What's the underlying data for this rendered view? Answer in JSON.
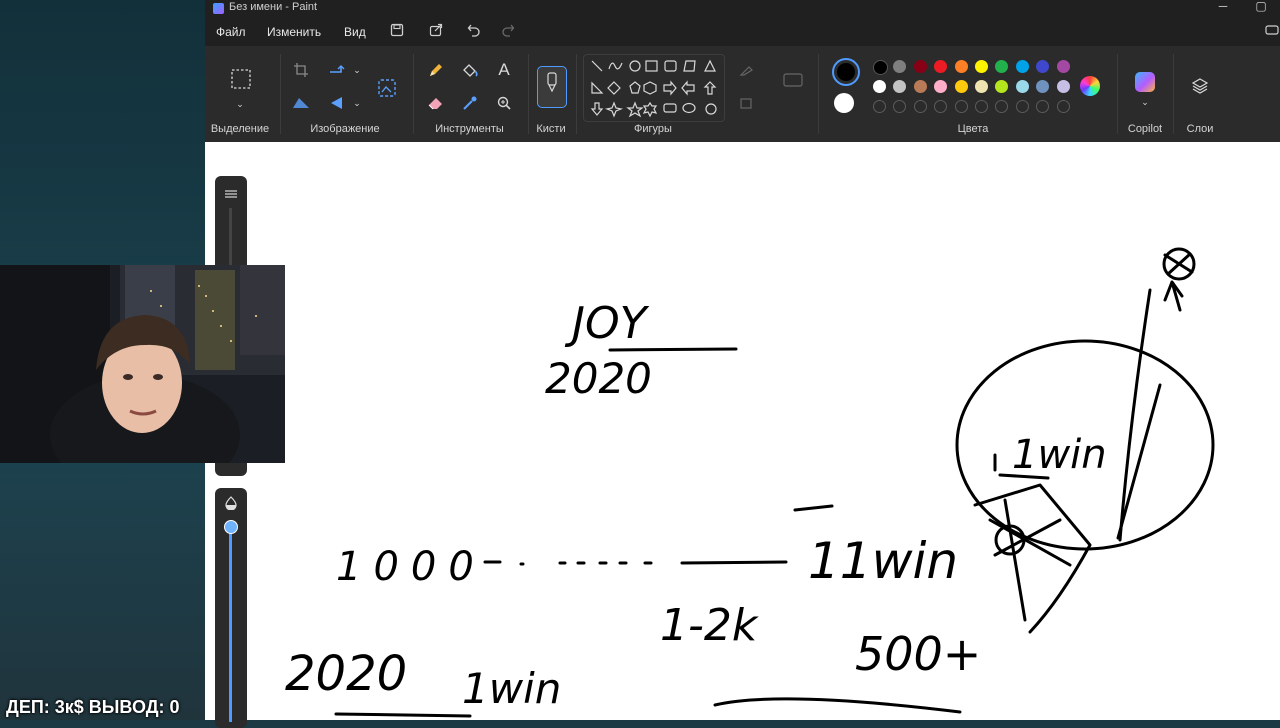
{
  "window": {
    "title": "Без имени - Paint"
  },
  "menu": {
    "file": "Файл",
    "edit": "Изменить",
    "view": "Вид"
  },
  "ribbon": {
    "groups": {
      "selection": "Выделение",
      "image": "Изображение",
      "tools": "Инструменты",
      "brushes": "Кисти",
      "shapes": "Фигуры",
      "colors": "Цвета",
      "copilot": "Copilot",
      "layers": "Слои"
    },
    "palette_row1": [
      "#000000",
      "#7f7f7f",
      "#880015",
      "#ed1c24",
      "#ff7f27",
      "#fff200",
      "#22b14c",
      "#00a2e8",
      "#3f48cc",
      "#a349a4"
    ],
    "palette_row2": [
      "#ffffff",
      "#c3c3c3",
      "#b97a57",
      "#ffaec9",
      "#ffc90e",
      "#efe4b0",
      "#b5e61d",
      "#99d9ea",
      "#7092be",
      "#c8bfe7"
    ]
  },
  "canvas_text": {
    "joy": "JOY",
    "y2020a": "2020",
    "onewin_circle": "1win",
    "n1000": "1000",
    "dashes": "- . - - - -",
    "onewin_mid": "11win",
    "range": "1-2k",
    "n500": "500+",
    "y2020b": "2020",
    "onewin_low": "1win"
  },
  "overlay": {
    "text": "ДЕП: 3к$ ВЫВОД: 0"
  }
}
